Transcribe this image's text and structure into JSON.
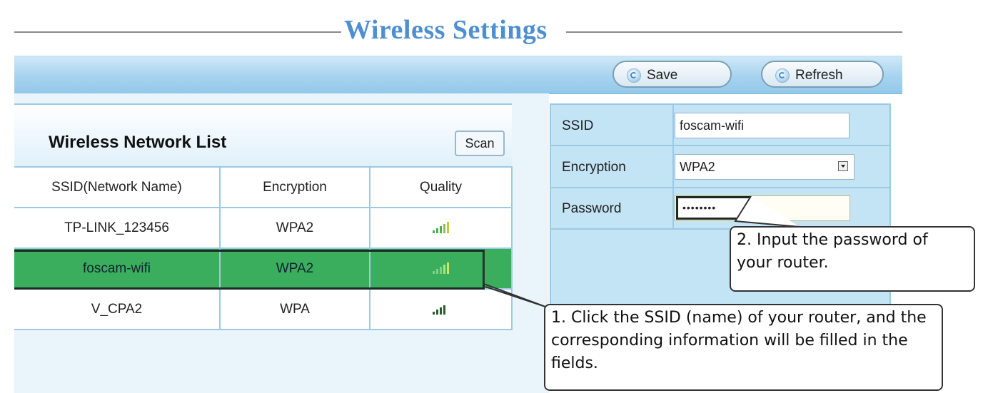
{
  "page": {
    "title": "Wireless Settings"
  },
  "toolbar": {
    "save_label": "Save",
    "refresh_label": "Refresh"
  },
  "network_list": {
    "title": "Wireless Network List",
    "scan_label": "Scan",
    "columns": [
      "SSID(Network Name)",
      "Encryption",
      "Quality"
    ],
    "rows": [
      {
        "ssid": "TP-LINK_123456",
        "encryption": "WPA2",
        "quality": "good",
        "selected": false
      },
      {
        "ssid": "foscam-wifi",
        "encryption": "WPA2",
        "quality": "good",
        "selected": true
      },
      {
        "ssid": "V_CPA2",
        "encryption": "WPA",
        "quality": "fair",
        "selected": false
      }
    ]
  },
  "form": {
    "ssid_label": "SSID",
    "ssid_value": "foscam-wifi",
    "encryption_label": "Encryption",
    "encryption_value": "WPA2",
    "password_label": "Password",
    "password_value": "••••••••"
  },
  "callouts": {
    "password": "2. Input the password of your router.",
    "ssid": "1. Click the SSID (name) of your router, and the corresponding information will be filled in the fields."
  },
  "colors": {
    "title": "#4f8fd0",
    "selected_row": "#3aae5c",
    "panel": "#c3e4f5",
    "border": "#9cc9e6"
  }
}
